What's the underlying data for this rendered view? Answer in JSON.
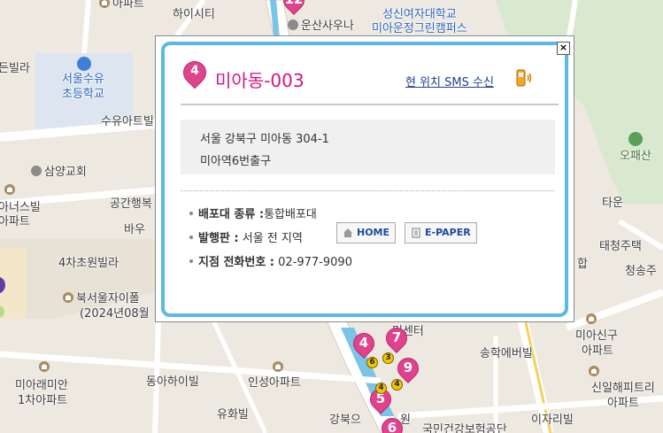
{
  "map_labels": {
    "apt_top": "아파트",
    "hi_city": "하이시티",
    "sauna": "운산사우나",
    "univ_line1": "성신여자대학교",
    "univ_line2": "미아운정그린캠퍼스",
    "villa_left": "든빌라",
    "school_line1": "서울수유",
    "school_line2": "초등학교",
    "suyu_apt": "수유아트빌",
    "church": "삼양교회",
    "aneos_villa": "아너스빌",
    "apt_left": "아파트",
    "gonggan": "공간행복",
    "bayu": "바우",
    "chacho_villa": "4차초원빌라",
    "north_seoul_line1": "북서울자이폴",
    "north_seoul_line2": "(2024년08월",
    "mirae_line1": "미아래미안",
    "mirae_line2": "1차아파트",
    "donga": "동아하이빌",
    "insung": "인성아파트",
    "yuhwa": "유화빌",
    "gangbuk": "강북으",
    "gangbuk_b": "원",
    "nhis": "국민건강보험공단",
    "ijaril": "이자리빌",
    "songhak": "송학에버빌",
    "sinil_line1": "신일해피트리",
    "sinil_line2": "아파트",
    "misin_line1": "미아신구",
    "misin_line2": "아파트",
    "chungsong": "청송주",
    "taecheong": "태청주택",
    "tawon": "타운",
    "mountain": "오패산",
    "minsenter": "민센터",
    "hap": "합",
    "apt_right": "아파트",
    "top_apt2": "아파트"
  },
  "map_pins": [
    {
      "num": "12"
    },
    {
      "num": "4"
    },
    {
      "num": "7"
    },
    {
      "num": "9"
    },
    {
      "num": "5"
    },
    {
      "num": "6"
    }
  ],
  "map_beads": [
    "3",
    "6",
    "4",
    "4"
  ],
  "popup": {
    "close_label": "×",
    "pin_number": "4",
    "title": "미아동-003",
    "sms_link": "현 위치 SMS 수신",
    "address_line1": "서울 강북구 미아동 304-1",
    "address_line2": "미아역6번출구",
    "delivery_type_label": "배포대 종류 :",
    "delivery_type_value": "통합배포대",
    "edition_label": "발행판 :",
    "edition_value": "서울 전 지역",
    "home_button": "HOME",
    "epaper_button": "E-PAPER",
    "phone_label": "지점 전화번호 :",
    "phone_value": "02-977-9090"
  },
  "colors": {
    "accent_pink": "#d6137f",
    "frame_blue": "#5cb8e6",
    "pin_pink": "#e0428c",
    "link_blue": "#1f3f8f"
  },
  "icons": [
    "close-icon",
    "map-pin-icon",
    "phone-signal-icon",
    "home-icon",
    "paper-icon",
    "building-icon",
    "school-icon",
    "church-icon",
    "mountain-icon"
  ]
}
